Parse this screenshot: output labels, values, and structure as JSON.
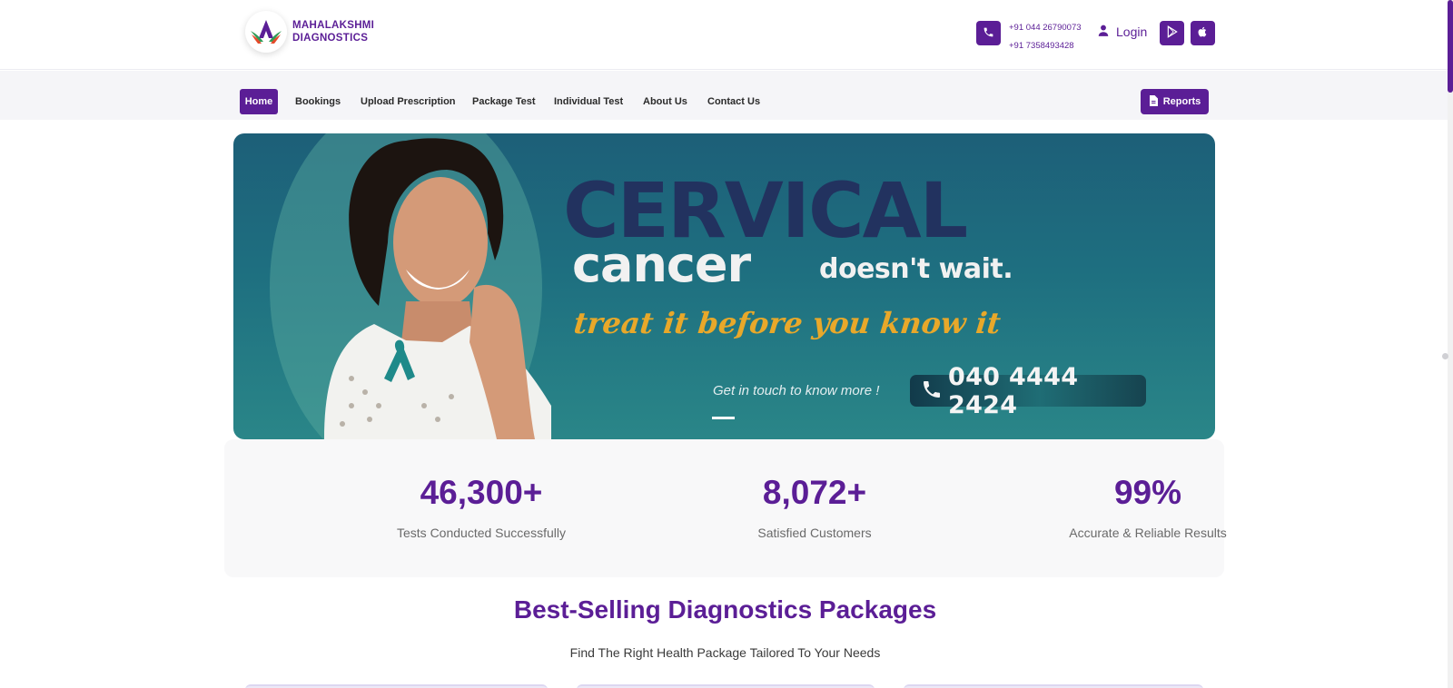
{
  "header": {
    "logo_line1": "MAHALAKSHMI",
    "logo_line2": "DIAGNOSTICS",
    "phone1": "+91 044 26790073",
    "phone2": "+91 7358493428",
    "login_label": "Login"
  },
  "nav": {
    "items": [
      "Home",
      "Bookings",
      "Upload Prescription",
      "Package Test",
      "Individual Test",
      "About Us",
      "Contact Us"
    ],
    "reports_label": "Reports"
  },
  "banner": {
    "headline_1": "CERVICAL",
    "headline_2": "cancer",
    "headline_3": "doesn't wait.",
    "tagline": "treat it before you know it",
    "touch_text": "Get in touch to know more !",
    "touch_number": "040 4444 2424"
  },
  "stats": [
    {
      "value": "46,300+",
      "label": "Tests Conducted Successfully"
    },
    {
      "value": "8,072+",
      "label": "Satisfied Customers"
    },
    {
      "value": "99%",
      "label": "Accurate & Reliable Results"
    }
  ],
  "section": {
    "title": "Best-Selling Diagnostics Packages",
    "subtitle": "Find The Right Health Package Tailored To Your Needs"
  },
  "colors": {
    "brand": "#5b1e96",
    "banner_teal": "#1e6f80",
    "banner_navy": "#22325f",
    "tagline_gold": "#e8a82a"
  },
  "icons": [
    "phone-icon",
    "user-icon",
    "play-store-icon",
    "apple-icon",
    "document-icon"
  ]
}
